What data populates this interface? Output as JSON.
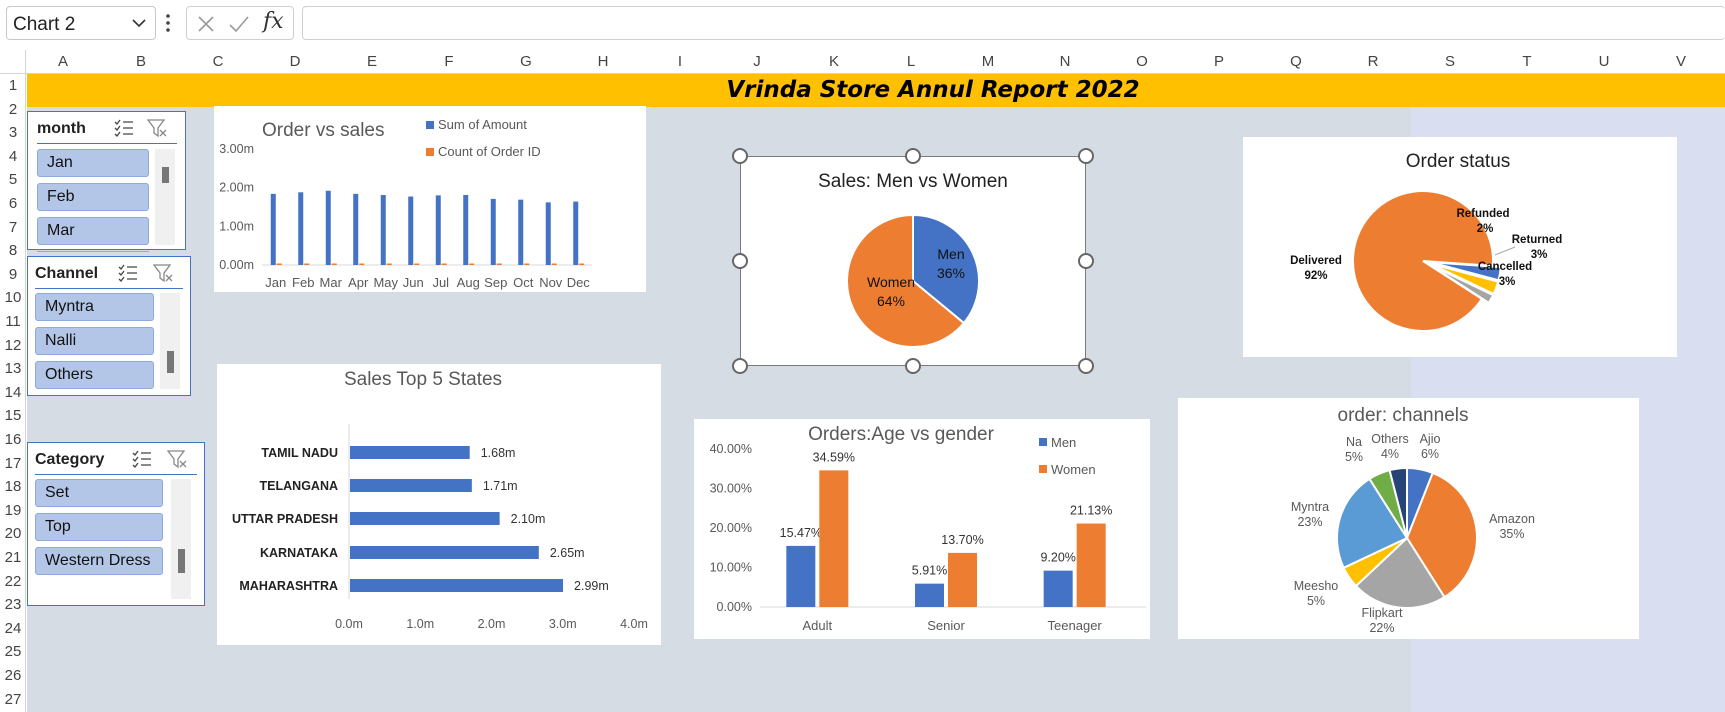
{
  "formula_bar": {
    "name_box": "Chart 2",
    "formula": ""
  },
  "columns": [
    "A",
    "B",
    "C",
    "D",
    "E",
    "F",
    "G",
    "H",
    "I",
    "J",
    "K",
    "L",
    "M",
    "N",
    "O",
    "P",
    "Q",
    "R",
    "S",
    "T",
    "U",
    "V"
  ],
  "rows": [
    "1",
    "2",
    "3",
    "4",
    "5",
    "6",
    "7",
    "8",
    "9",
    "10",
    "11",
    "12",
    "13",
    "14",
    "15",
    "16",
    "17",
    "18",
    "19",
    "20",
    "21",
    "22",
    "23",
    "24",
    "25",
    "26",
    "27"
  ],
  "banner": {
    "title": "Vrinda Store Annul Report 2022",
    "color": "#ffc000"
  },
  "slicers": {
    "month": {
      "title": "month",
      "items": [
        "Jan",
        "Feb",
        "Mar"
      ]
    },
    "channel": {
      "title": "Channel",
      "items": [
        "Myntra",
        "Nalli",
        "Others"
      ]
    },
    "category": {
      "title": "Category",
      "items": [
        "Set",
        "Top",
        "Western Dress"
      ]
    }
  },
  "colors": {
    "blue": "#4472c4",
    "orange": "#ed7d31",
    "gray": "#a5a5a5",
    "gold": "#ffc000",
    "lightblue": "#5b9bd5",
    "green": "#70ad47",
    "navy": "#264478"
  },
  "chart_data": [
    {
      "id": "order_vs_sales",
      "type": "bar",
      "title": "Order vs sales",
      "categories": [
        "Jan",
        "Feb",
        "Mar",
        "Apr",
        "May",
        "Jun",
        "Jul",
        "Aug",
        "Sep",
        "Oct",
        "Nov",
        "Dec"
      ],
      "series": [
        {
          "name": "Sum of Amount",
          "values": [
            1.84,
            1.88,
            1.92,
            1.84,
            1.81,
            1.77,
            1.8,
            1.81,
            1.71,
            1.69,
            1.62,
            1.64
          ]
        },
        {
          "name": "Count of Order ID",
          "values": [
            0.0028,
            0.0028,
            0.0029,
            0.0028,
            0.0027,
            0.0027,
            0.0027,
            0.0027,
            0.0026,
            0.0025,
            0.0024,
            0.0025
          ]
        }
      ],
      "y_ticks": [
        "0.00m",
        "1.00m",
        "2.00m",
        "3.00m"
      ],
      "ylim": [
        0,
        3
      ],
      "legend_position": "top"
    },
    {
      "id": "sales_men_women",
      "type": "pie",
      "title": "Sales: Men vs Women",
      "slices": [
        {
          "label": "Men",
          "value": 36,
          "value_label": "36%"
        },
        {
          "label": "Women",
          "value": 64,
          "value_label": "64%"
        }
      ]
    },
    {
      "id": "order_status",
      "type": "pie",
      "title": "Order status",
      "slices": [
        {
          "label": "Cancelled",
          "value": 3,
          "value_label": "3%"
        },
        {
          "label": "Returned",
          "value": 3,
          "value_label": "3%"
        },
        {
          "label": "Refunded",
          "value": 2,
          "value_label": "2%"
        },
        {
          "label": "Delivered",
          "value": 92,
          "value_label": "92%"
        }
      ]
    },
    {
      "id": "sales_top5_states",
      "type": "bar",
      "orientation": "horizontal",
      "title": "Sales Top 5 States",
      "categories": [
        "TAMIL NADU",
        "TELANGANA",
        "UTTAR PRADESH",
        "KARNATAKA",
        "MAHARASHTRA"
      ],
      "values": [
        1.68,
        1.71,
        2.1,
        2.65,
        2.99
      ],
      "value_labels": [
        "1.68m",
        "1.71m",
        "2.10m",
        "2.65m",
        "2.99m"
      ],
      "x_ticks": [
        "0.0m",
        "1.0m",
        "2.0m",
        "3.0m",
        "4.0m"
      ],
      "xlim": [
        0,
        4
      ]
    },
    {
      "id": "orders_age_gender",
      "type": "bar",
      "title": "Orders:Age vs gender",
      "categories": [
        "Adult",
        "Senior",
        "Teenager"
      ],
      "series": [
        {
          "name": "Men",
          "values": [
            15.47,
            5.91,
            9.2
          ],
          "value_labels": [
            "15.47%",
            "5.91%",
            "9.20%"
          ]
        },
        {
          "name": "Women",
          "values": [
            34.59,
            13.7,
            21.13
          ],
          "value_labels": [
            "34.59%",
            "13.70%",
            "21.13%"
          ]
        }
      ],
      "y_ticks": [
        "0.00%",
        "10.00%",
        "20.00%",
        "30.00%",
        "40.00%"
      ],
      "ylim": [
        0,
        40
      ],
      "legend_position": "top-right"
    },
    {
      "id": "order_channels",
      "type": "pie",
      "title": "order: channels",
      "slices": [
        {
          "label": "Ajio",
          "value": 6,
          "value_label": "6%"
        },
        {
          "label": "Amazon",
          "value": 35,
          "value_label": "35%"
        },
        {
          "label": "Flipkart",
          "value": 22,
          "value_label": "22%"
        },
        {
          "label": "Meesho",
          "value": 5,
          "value_label": "5%"
        },
        {
          "label": "Myntra",
          "value": 23,
          "value_label": "23%"
        },
        {
          "label": "Na",
          "value": 5,
          "value_label": "5%"
        },
        {
          "label": "Others",
          "value": 4,
          "value_label": "4%"
        }
      ]
    }
  ]
}
